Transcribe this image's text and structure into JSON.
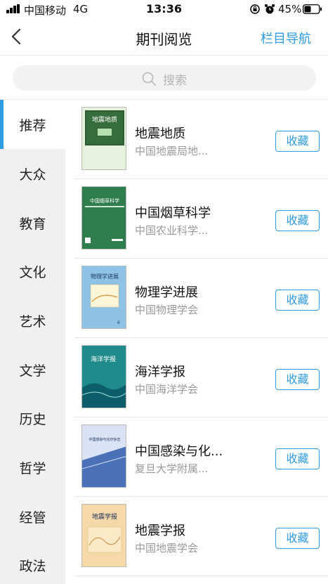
{
  "status_bar": {
    "carrier": "中国移动",
    "network": "4G",
    "time": "13:36",
    "battery_percent": "45%"
  },
  "nav": {
    "back_icon": "chevron-left-icon",
    "title": "期刊阅览",
    "action_label": "栏目导航"
  },
  "search": {
    "placeholder": "搜索",
    "icon": "search-icon"
  },
  "sidebar": {
    "items": [
      {
        "label": "推荐",
        "active": true
      },
      {
        "label": "大众"
      },
      {
        "label": "教育"
      },
      {
        "label": "文化"
      },
      {
        "label": "艺术"
      },
      {
        "label": "文学"
      },
      {
        "label": "历史"
      },
      {
        "label": "哲学"
      },
      {
        "label": "经管"
      },
      {
        "label": "政法"
      }
    ]
  },
  "journals": [
    {
      "title": "地震地质",
      "publisher": "中国地震局地...",
      "action": "收藏",
      "cover_text": "地震地质",
      "cover_color": "#e6f2de"
    },
    {
      "title": "中国烟草科学",
      "publisher": "中国农业科学...",
      "action": "收藏",
      "cover_text": "中国烟草科学",
      "cover_color": "#2f7d4d"
    },
    {
      "title": "物理学进展",
      "publisher": "中国物理学会",
      "action": "收藏",
      "cover_text": "物理学进展",
      "cover_color": "#8fc3e6"
    },
    {
      "title": "海洋学报",
      "publisher": "中国海洋学会",
      "action": "收藏",
      "cover_text": "海洋学报",
      "cover_color": "#1f8b8a"
    },
    {
      "title": "中国感染与化...",
      "publisher": "复旦大学附属...",
      "action": "收藏",
      "cover_text": "中国感染与化疗杂志",
      "cover_color": "#4a70b8"
    },
    {
      "title": "地震学报",
      "publisher": "中国地震学会",
      "action": "收藏",
      "cover_text": "地震学报",
      "cover_color": "#f5d9a8"
    }
  ],
  "colors": {
    "accent": "#2f9be0",
    "sidebar_bg": "#f0f0f0",
    "secondary_text": "#999999"
  }
}
